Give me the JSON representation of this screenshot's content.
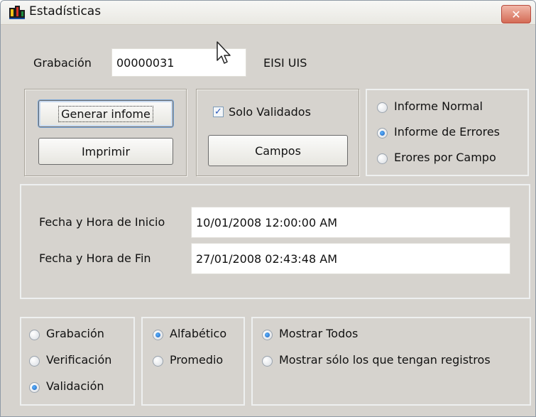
{
  "window": {
    "title": "Estadísticas",
    "close_label": "✕"
  },
  "header": {
    "grabacion_label": "Grabación",
    "grabacion_value": "00000031",
    "org": "EISI UIS"
  },
  "actions": {
    "generar": "Generar infome",
    "imprimir": "Imprimir"
  },
  "filters": {
    "solo_validados": "Solo Validados",
    "campos": "Campos"
  },
  "report_type": {
    "options": [
      "Informe Normal",
      "Informe de Errores",
      "Erores por Campo"
    ],
    "selected": "Informe de Errores"
  },
  "dates": {
    "inicio_label": "Fecha y Hora de Inicio",
    "inicio_value": "10/01/2008 12:00:00 AM",
    "fin_label": "Fecha y Hora de Fin",
    "fin_value": "27/01/2008 02:43:48 AM"
  },
  "stage": {
    "options": [
      "Grabación",
      "Verificación",
      "Validación"
    ],
    "selected": "Validación"
  },
  "order": {
    "options": [
      "Alfabético",
      "Promedio"
    ],
    "selected": "Alfabético"
  },
  "show": {
    "options": [
      "Mostrar Todos",
      "Mostrar sólo los que tengan registros"
    ],
    "selected": "Mostrar Todos"
  }
}
